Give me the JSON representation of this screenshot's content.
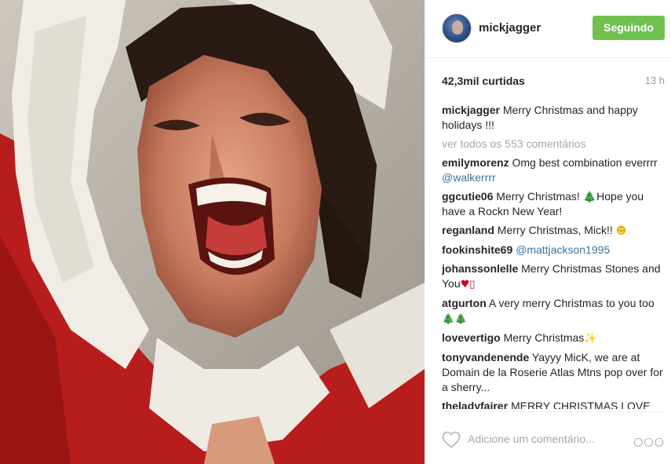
{
  "post": {
    "username": "mickjagger",
    "follow_button": "Seguindo",
    "likes": "42,3mil curtidas",
    "time": "13 h",
    "caption_user": "mickjagger",
    "caption_text": "Merry Christmas and happy holidays !!!",
    "view_all": "ver todos os 553 comentários",
    "comment_placeholder": "Adicione um comentário..."
  },
  "comments": [
    {
      "user": "emilymorenz",
      "text": "Omg best combination everrrr",
      "mention": "@walkerrrr",
      "emoji": ""
    },
    {
      "user": "ggcutie06",
      "text": "Merry Christmas! 🎄Hope you have a Rockn New Year!",
      "mention": "",
      "emoji": ""
    },
    {
      "user": "reganland",
      "text": "Merry Christmas, Mick!!",
      "mention": "",
      "emoji": "☻"
    },
    {
      "user": "fookinshite69",
      "text": "",
      "mention": "@mattjackson1995",
      "emoji": ""
    },
    {
      "user": "johanssonlelle",
      "text": "Merry Christmas Stones and You",
      "mention": "",
      "emoji": "♥▯"
    },
    {
      "user": "atgurton",
      "text": "A very merry Christmas to you too",
      "mention": "",
      "emoji": "🎄🎄"
    },
    {
      "user": "lovevertigo",
      "text": "Merry Christmas",
      "mention": "",
      "emoji": "✨"
    },
    {
      "user": "tonyvandenende",
      "text": "Yayyy MicK, we are at Domain de la Roserie Atlas Mtns pop over for a sherry...",
      "mention": "",
      "emoji": ""
    },
    {
      "user": "theladyfairer",
      "text": "MERRY CHRISTMAS LOVE",
      "mention": "",
      "emoji": ""
    }
  ],
  "icons": {
    "like": "heart-outline-icon",
    "more": "more-options-icon",
    "avatar": "profile-avatar"
  },
  "colors": {
    "follow_button": "#70c050",
    "username": "#262626",
    "mention": "#3f729b",
    "muted": "#a5a7aa"
  }
}
